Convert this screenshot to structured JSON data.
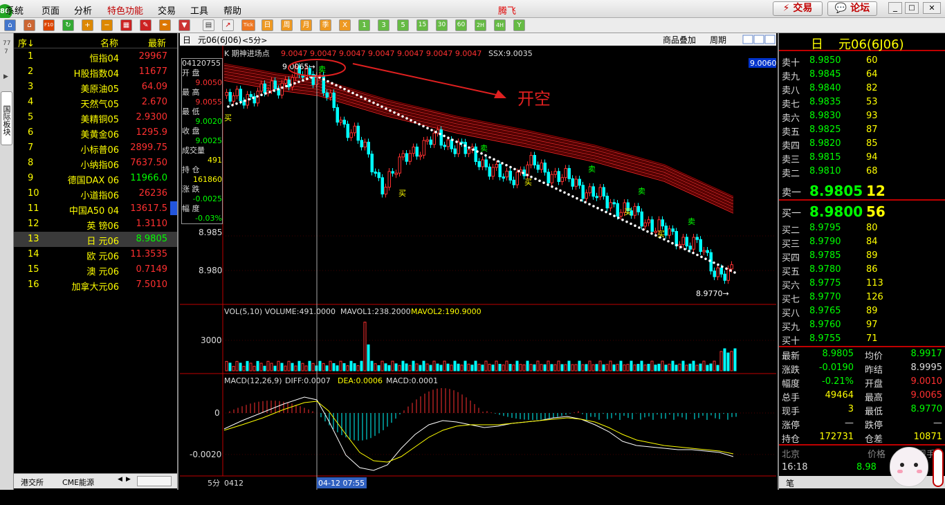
{
  "menu": {
    "items": [
      "系统",
      "页面",
      "分析",
      "特色功能",
      "交易",
      "工具",
      "帮助"
    ],
    "brand": "腾飞",
    "trade_button": "交易",
    "forum_button": "论坛",
    "badge": "80"
  },
  "toolbar": {
    "text_buttons": [
      "Tick",
      "日",
      "周",
      "月",
      "季",
      "X",
      "1",
      "3",
      "5",
      "15",
      "30",
      "60",
      "2H",
      "4H",
      "Y"
    ]
  },
  "sidetab": {
    "label": "国际板块",
    "top_num": "77",
    "top_num2": "7"
  },
  "left_panel": {
    "headers": {
      "seq": "序↓",
      "name": "名称",
      "price": "最新"
    },
    "rows": [
      {
        "seq": "1",
        "name": "恒指04",
        "price": "29967",
        "pcolor": "#ff3030"
      },
      {
        "seq": "2",
        "name": "H股指数04",
        "price": "11677",
        "pcolor": "#ff3030"
      },
      {
        "seq": "3",
        "name": "美原油05",
        "price": "64.09",
        "pcolor": "#ff3030"
      },
      {
        "seq": "4",
        "name": "天然气05",
        "price": "2.670",
        "pcolor": "#ff3030"
      },
      {
        "seq": "5",
        "name": "美精铜05",
        "price": "2.9300",
        "pcolor": "#ff3030"
      },
      {
        "seq": "6",
        "name": "美黄金06",
        "price": "1295.9",
        "pcolor": "#ff3030"
      },
      {
        "seq": "7",
        "name": "小标普06",
        "price": "2899.75",
        "pcolor": "#ff3030"
      },
      {
        "seq": "8",
        "name": "小纳指06",
        "price": "7637.50",
        "pcolor": "#ff3030"
      },
      {
        "seq": "9",
        "name": "德国DAX 06",
        "price": "11966.0",
        "pcolor": "#00ff00"
      },
      {
        "seq": "10",
        "name": "小道指06",
        "price": "26236",
        "pcolor": "#ff3030"
      },
      {
        "seq": "11",
        "name": "中国A50 04",
        "price": "13617.5",
        "pcolor": "#ff3030"
      },
      {
        "seq": "12",
        "name": "英  镑06",
        "price": "1.3110",
        "pcolor": "#ff3030"
      },
      {
        "seq": "13",
        "name": "日  元06",
        "price": "8.9805",
        "pcolor": "#00ff00"
      },
      {
        "seq": "14",
        "name": "欧  元06",
        "price": "11.3535",
        "pcolor": "#ff3030"
      },
      {
        "seq": "15",
        "name": "澳  元06",
        "price": "0.7149",
        "pcolor": "#ff3030"
      },
      {
        "seq": "16",
        "name": "加拿大元06",
        "price": "7.5010",
        "pcolor": "#ff3030"
      }
    ],
    "bottom_tabs": [
      "港交所",
      "CME能源"
    ]
  },
  "chart": {
    "tabs": {
      "period_tab": "日",
      "contract": "元06(6J06)",
      "interval": "<5分>",
      "overlay": "商品叠加",
      "cycle": "周期"
    },
    "legend": {
      "prefix": "K  期神进场点",
      "values": "9.0047 9.0047 9.0047 9.0047 9.0047 9.0047 9.0047",
      "ssx": "SSX:9.0035"
    },
    "info_box": {
      "date": "04120755",
      "open_label": "开  盘",
      "open": "9.0050",
      "high_label": "最  高",
      "high": "9.0055",
      "low_label": "最  低",
      "low": "9.0020",
      "close_label": "收  盘",
      "close": "9.0025",
      "vol_label": "成交量",
      "vol": "491",
      "oi_label": "持  仓",
      "oi": "161860",
      "chg_label": "涨  跌",
      "chg": "-0.0025",
      "pct_label": "幅  度",
      "pct": "-0.03%"
    },
    "price_axis": [
      "8.985",
      "8.980"
    ],
    "price_tag": "9.0060",
    "high_mark": "9.0065→",
    "low_mark": "8.9770→",
    "annotation": "开空",
    "signals": {
      "sell": "卖",
      "buy": "买"
    },
    "vol_legend": {
      "label": "VOL(5,10) VOLUME:491.0000",
      "mavol1": "MAVOL1:238.2000",
      "mavol2": "MAVOL2:190.9000",
      "axis": "3000"
    },
    "macd_legend": {
      "label": "MACD(12,26,9)",
      "diff": "DIFF:0.0007",
      "dea": "DEA:0.0006",
      "macd": "MACD:0.0001",
      "axis0": "0",
      "axis1": "-0.0020"
    },
    "bottom": {
      "period": "5分",
      "start": "0412",
      "cursor_time": "04-12 07:55"
    }
  },
  "quote": {
    "title_prefix": "日",
    "title_name": "元06(6J06)",
    "asks": [
      {
        "label": "卖十",
        "price": "8.9850",
        "vol": "60"
      },
      {
        "label": "卖九",
        "price": "8.9845",
        "vol": "64"
      },
      {
        "label": "卖八",
        "price": "8.9840",
        "vol": "82"
      },
      {
        "label": "卖七",
        "price": "8.9835",
        "vol": "53"
      },
      {
        "label": "卖六",
        "price": "8.9830",
        "vol": "93"
      },
      {
        "label": "卖五",
        "price": "8.9825",
        "vol": "87"
      },
      {
        "label": "卖四",
        "price": "8.9820",
        "vol": "85"
      },
      {
        "label": "卖三",
        "price": "8.9815",
        "vol": "94"
      },
      {
        "label": "卖二",
        "price": "8.9810",
        "vol": "68"
      }
    ],
    "ask1": {
      "label": "卖一",
      "price": "8.9805",
      "vol": "12"
    },
    "bid1": {
      "label": "买一",
      "price": "8.9800",
      "vol": "56"
    },
    "bids": [
      {
        "label": "买二",
        "price": "8.9795",
        "vol": "80"
      },
      {
        "label": "买三",
        "price": "8.9790",
        "vol": "84"
      },
      {
        "label": "买四",
        "price": "8.9785",
        "vol": "89"
      },
      {
        "label": "买五",
        "price": "8.9780",
        "vol": "86"
      },
      {
        "label": "买六",
        "price": "8.9775",
        "vol": "113"
      },
      {
        "label": "买七",
        "price": "8.9770",
        "vol": "126"
      },
      {
        "label": "买八",
        "price": "8.9765",
        "vol": "89"
      },
      {
        "label": "买九",
        "price": "8.9760",
        "vol": "97"
      },
      {
        "label": "买十",
        "price": "8.9755",
        "vol": "71"
      }
    ],
    "stats": [
      {
        "l1": "最新",
        "v1": "8.9805",
        "c1": "#00ff00",
        "l2": "均价",
        "v2": "8.9917",
        "c2": "#00ff00"
      },
      {
        "l1": "涨跌",
        "v1": "-0.0190",
        "c1": "#00ff00",
        "l2": "昨结",
        "v2": "8.9995",
        "c2": "#dddddd"
      },
      {
        "l1": "幅度",
        "v1": "-0.21%",
        "c1": "#00ff00",
        "l2": "开盘",
        "v2": "9.0010",
        "c2": "#ff3030"
      },
      {
        "l1": "总手",
        "v1": "49464",
        "c1": "#ffff00",
        "l2": "最高",
        "v2": "9.0065",
        "c2": "#ff3030"
      },
      {
        "l1": "现手",
        "v1": "3",
        "c1": "#ffff00",
        "l2": "最低",
        "v2": "8.9770",
        "c2": "#00ff00"
      },
      {
        "l1": "涨停",
        "v1": "—",
        "c1": "#dddddd",
        "l2": "跌停",
        "v2": "—",
        "c2": "#dddddd"
      },
      {
        "l1": "持仓",
        "v1": "172731",
        "c1": "#ffff00",
        "l2": "仓差",
        "v2": "10871",
        "c2": "#ffff00"
      }
    ],
    "trade_header": {
      "place": "北京",
      "price": "价格",
      "cur": "现手"
    },
    "trade_row": {
      "time": "16:18",
      "price": "8.98"
    },
    "bottom_tab": "笔"
  },
  "colors": {
    "up": "#ff3030",
    "down": "#00ffff",
    "ma_band": "#d00000",
    "accent": "#ffff00"
  }
}
